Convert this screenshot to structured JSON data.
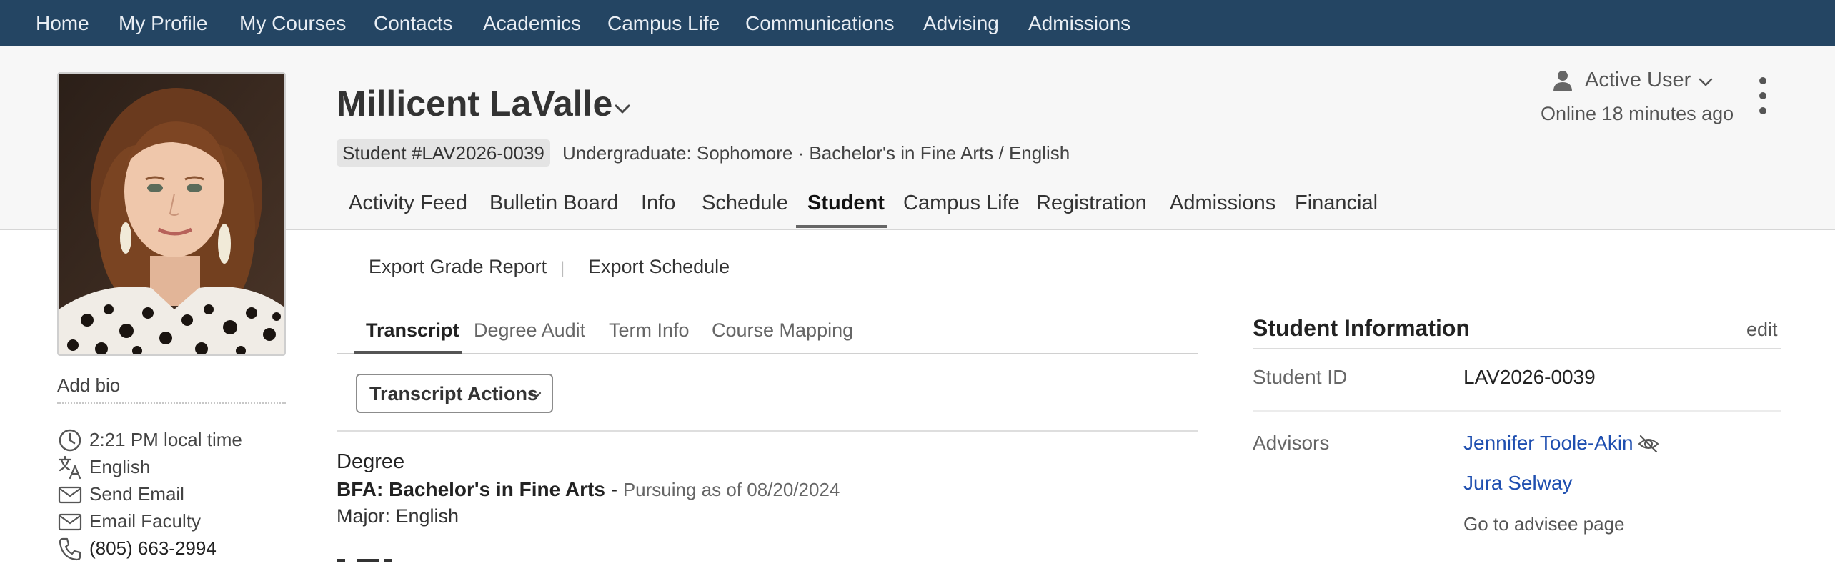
{
  "colors": {
    "nav_background": "#244563",
    "nav_text": "#e9eef4",
    "header_background": "#f7f7f7",
    "link": "#1f4fb0"
  },
  "topnav": {
    "items": [
      {
        "label": "Home"
      },
      {
        "label": "My Profile"
      },
      {
        "label": "My Courses"
      },
      {
        "label": "Contacts"
      },
      {
        "label": "Academics"
      },
      {
        "label": "Campus Life"
      },
      {
        "label": "Communications"
      },
      {
        "label": "Advising"
      },
      {
        "label": "Admissions"
      }
    ]
  },
  "profile": {
    "name": "Millicent LaValle",
    "student_number": "Student #LAV2026-0039",
    "subtitle": "Undergraduate: Sophomore · Bachelor's in Fine Arts / English",
    "status_user": "Active User",
    "online": "Online 18 minutes ago"
  },
  "profile_tabs": [
    {
      "label": "Activity Feed"
    },
    {
      "label": "Bulletin Board"
    },
    {
      "label": "Info"
    },
    {
      "label": "Schedule"
    },
    {
      "label": "Student",
      "active": true
    },
    {
      "label": "Campus Life"
    },
    {
      "label": "Registration"
    },
    {
      "label": "Admissions"
    },
    {
      "label": "Financial"
    }
  ],
  "sidebar": {
    "add_bio": "Add bio",
    "local_time": "2:21 PM local time",
    "language": "English",
    "send_email": "Send Email",
    "email_faculty": "Email Faculty",
    "phone": "(805) 663-2994"
  },
  "exports": {
    "grade_report": "Export Grade Report",
    "separator": "|",
    "schedule": "Export Schedule"
  },
  "sub_tabs": [
    {
      "label": "Transcript",
      "active": true
    },
    {
      "label": "Degree Audit"
    },
    {
      "label": "Term Info"
    },
    {
      "label": "Course Mapping"
    }
  ],
  "transcript": {
    "actions_label": "Transcript Actions",
    "degree_label": "Degree",
    "degree_title": "BFA: Bachelor's in Fine Arts",
    "degree_dash": " - ",
    "degree_status": "Pursuing as of 08/20/2024",
    "major": "Major: English"
  },
  "student_info": {
    "title": "Student Information",
    "edit": "edit",
    "student_id_label": "Student ID",
    "student_id_value": "LAV2026-0039",
    "advisors_label": "Advisors",
    "advisors": [
      "Jennifer Toole-Akin",
      "Jura Selway"
    ],
    "advisee_page": "Go to advisee page"
  },
  "icons": {
    "profile_dropdown": "chevron-down-icon",
    "user": "user-icon",
    "more": "more-vertical-icon",
    "clock": "clock-icon",
    "language": "translate-icon",
    "email": "mail-icon",
    "phone": "phone-icon",
    "hidden": "eye-off-icon"
  }
}
